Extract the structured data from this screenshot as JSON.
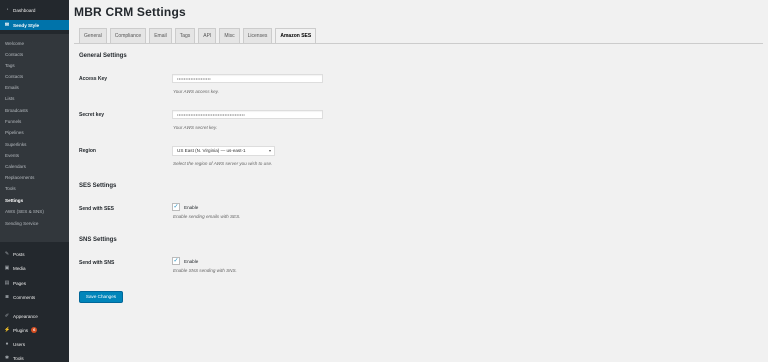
{
  "sidebar": {
    "dashboard": {
      "label": "Dashboard",
      "icon": "dashboard-icon"
    },
    "plugin_menu": {
      "label": "Sendy Style",
      "icon": "mail-icon"
    },
    "submenu": [
      "Welcome",
      "Contacts",
      "Tags",
      "Contacts",
      "Emails",
      "Lists",
      "Broadcasts",
      "Funnels",
      "Pipelines",
      "Superlinks",
      "Events",
      "Calendars",
      "Replacements",
      "Tools",
      "Settings",
      "AWS (SES & SNS)",
      "Sending Service"
    ],
    "current_submenu_index": 14,
    "bottom": [
      {
        "label": "Posts",
        "icon": "pin-icon"
      },
      {
        "label": "Media",
        "icon": "media-icon"
      },
      {
        "label": "Pages",
        "icon": "pages-icon"
      },
      {
        "label": "Comments",
        "icon": "comments-icon"
      },
      {
        "label": "Appearance",
        "icon": "brush-icon"
      },
      {
        "label": "Plugins",
        "icon": "plug-icon",
        "badge": "6"
      },
      {
        "label": "Users",
        "icon": "users-icon"
      },
      {
        "label": "Tools",
        "icon": "wrench-icon"
      }
    ]
  },
  "page": {
    "title": "MBR CRM Settings"
  },
  "tabs": [
    "General",
    "Compliance",
    "Email",
    "Tags",
    "API",
    "Misc",
    "Licenses",
    "Amazon SES"
  ],
  "active_tab_index": 7,
  "general": {
    "title": "General Settings",
    "access_key": {
      "label": "Access Key",
      "value": "••••••••••••••••••••",
      "description": "Your AWS access key."
    },
    "secret_key": {
      "label": "Secret key",
      "value": "••••••••••••••••••••••••••••••••••••••••",
      "description": "Your AWS secret key."
    },
    "region": {
      "label": "Region",
      "value": "US East (N. Virginia) — us-east-1",
      "description": "Select the region of AWS server you wish to use."
    }
  },
  "ses": {
    "title": "SES Settings",
    "label": "Send with SES",
    "checkbox_label": "Enable",
    "checked": true,
    "description": "Enable sending emails with SES."
  },
  "sns": {
    "title": "SNS Settings",
    "label": "Send with SNS",
    "checkbox_label": "Enable",
    "checked": true,
    "description": "Enable SNS sending with SNS."
  },
  "save_button": {
    "label": "Save Changes"
  },
  "colors": {
    "sidebar": "#23282d",
    "accent": "#0073aa",
    "button": "#0085ba",
    "background": "#f1f1f1"
  }
}
